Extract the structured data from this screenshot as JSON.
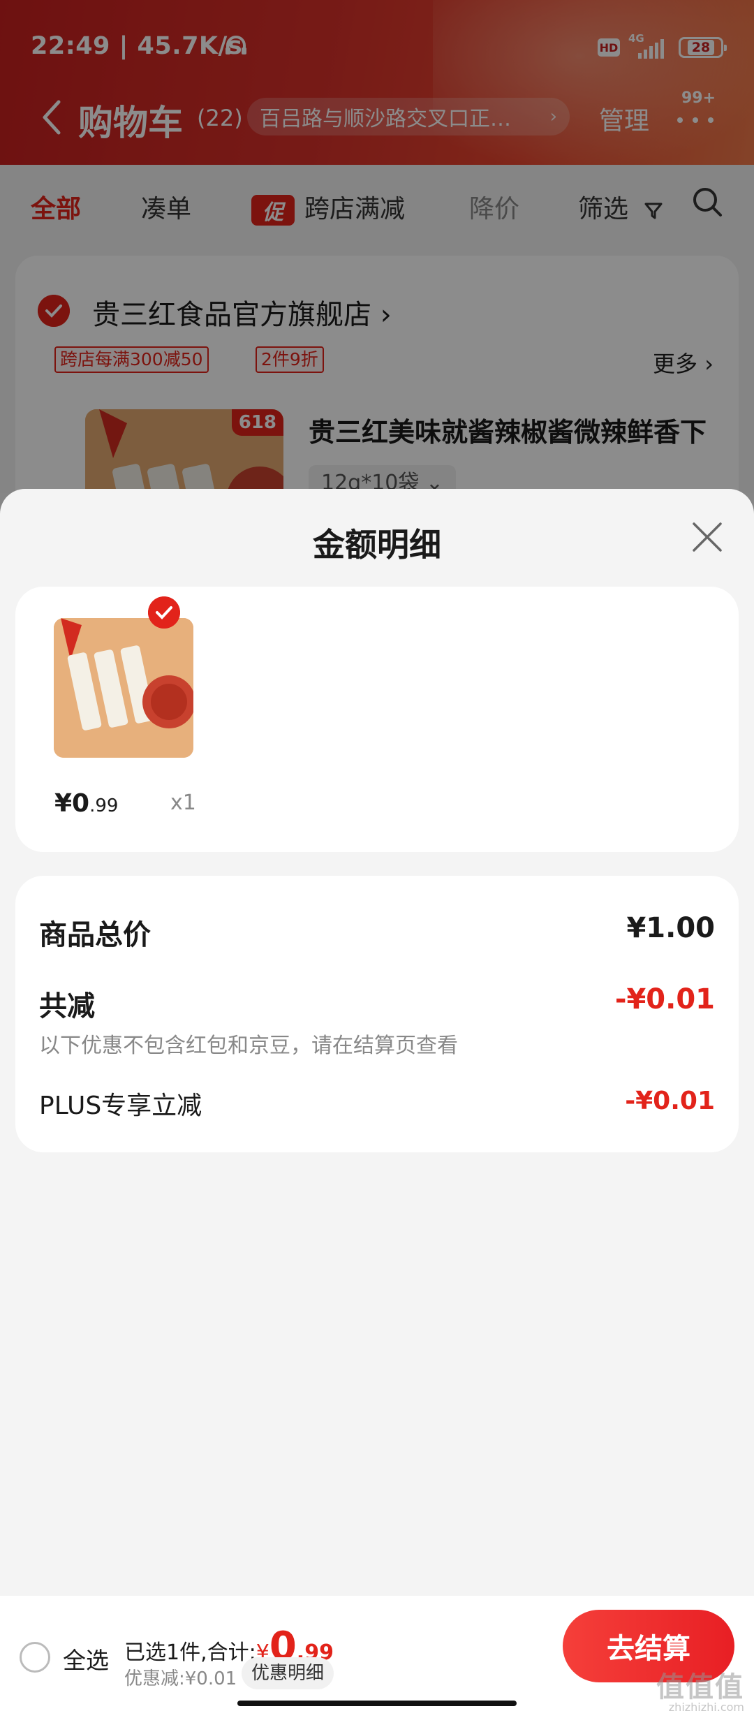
{
  "status_bar": {
    "time_speed": "22:49 | 45.7K/s",
    "hd": "HD",
    "network": "4G",
    "battery": "28"
  },
  "nav": {
    "title": "购物车",
    "count": "(22)",
    "address": "百吕路与顺沙路交叉口正…",
    "manage": "管理",
    "badge": "99+"
  },
  "filters": {
    "all": "全部",
    "bundle": "凑单",
    "promo_tag": "促",
    "cross_store": "跨店满减",
    "price_drop": "降价",
    "filter": "筛选"
  },
  "shop": {
    "name": "贵三红食品官方旗舰店 ›",
    "promo_1": "跨店每满300减50",
    "promo_2": "2件9折",
    "more": "更多 ›",
    "product_badge": "618",
    "product_title": "贵三红美味就酱辣椒酱微辣鲜香下",
    "product_spec": "12g*10袋 ⌄"
  },
  "sheet": {
    "title": "金额明细",
    "item": {
      "price_main": "¥0",
      "price_dec": ".99",
      "qty": "x1"
    },
    "summary": {
      "total_label": "商品总价",
      "total_value": "¥1.00",
      "reduce_label": "共减",
      "reduce_value": "-¥0.01",
      "note": "以下优惠不包含红包和京豆，请在结算页查看",
      "plus_label": "PLUS专享立减",
      "plus_value": "-¥0.01"
    }
  },
  "footer": {
    "select_all": "全选",
    "selected_prefix": "已选1件,合计:",
    "currency": "¥",
    "amount_main": "0",
    "amount_dec": ".99",
    "discount": "优惠减:¥0.01",
    "detail_chip": "优惠明细",
    "checkout": "去结算",
    "watermark": "值值值",
    "watermark_sub": "zhizhizhi.com"
  },
  "colors": {
    "accent": "#e2231a",
    "header": "#c8201f"
  }
}
